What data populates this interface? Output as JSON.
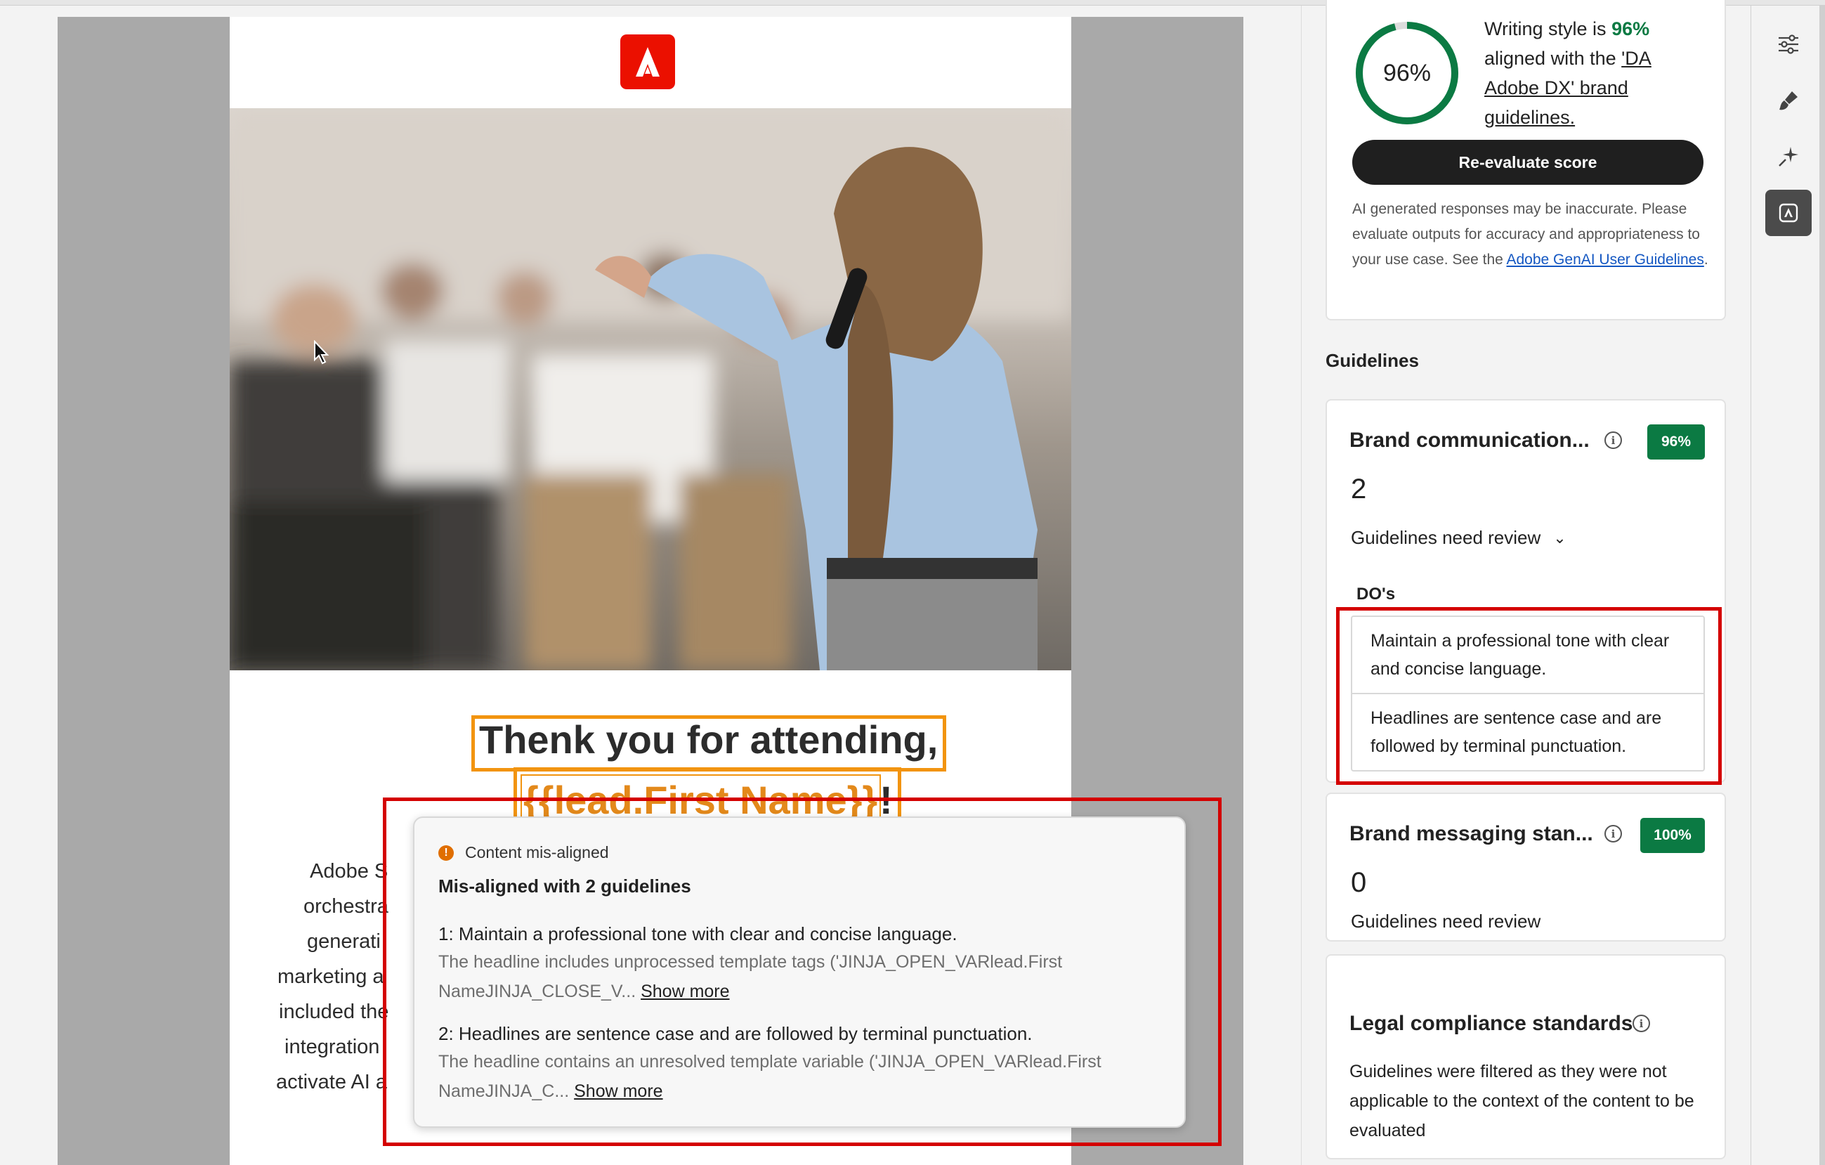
{
  "email": {
    "headline_line1": "Thenk you for attending,",
    "headline_var": "{{lead.First Name}}",
    "headline_punct": "!",
    "body_fragments": [
      "Adobe S",
      "orchestra",
      "generati",
      "marketing a",
      "included the",
      "integration",
      "activate AI a"
    ]
  },
  "popover": {
    "status": "Content mis-aligned",
    "title": "Mis-aligned with 2 guidelines",
    "items": [
      {
        "label": "1: Maintain a professional tone with clear and concise language.",
        "detail_line1": "The headline includes unprocessed template tags ('JINJA_OPEN_VARlead.First",
        "detail_line2": "NameJINJA_CLOSE_V...",
        "show_more": "Show more"
      },
      {
        "label": "2: Headlines are sentence case and are followed by terminal punctuation.",
        "detail_line1": "The headline contains an unresolved template variable ('JINJA_OPEN_VARlead.First",
        "detail_line2": "NameJINJA_C...",
        "show_more": "Show more"
      }
    ]
  },
  "score": {
    "value_label": "96%",
    "value": 96,
    "text_prefix": "Writing style is",
    "text_pct": "96%",
    "text_mid": "aligned with the",
    "guideline_link": "'DA Adobe DX' brand guidelines.",
    "reevaluate_label": "Re-evaluate score",
    "disclaimer": "AI generated responses may be inaccurate. Please evaluate outputs for accuracy and appropriateness to your use case. See the",
    "disclaimer_link": "Adobe GenAI User Guidelines",
    "disclaimer_end": "."
  },
  "guidelines": {
    "heading": "Guidelines",
    "cards": [
      {
        "title": "Brand communication...",
        "badge": "96%",
        "count": "2",
        "review_label": "Guidelines need review",
        "dos_label": "DO's",
        "dos": [
          "Maintain a professional tone with clear and concise language.",
          "Headlines are sentence case and are followed by terminal punctuation."
        ]
      },
      {
        "title": "Brand messaging stan...",
        "badge": "100%",
        "count": "0",
        "review_label": "Guidelines need review"
      },
      {
        "title": "Legal compliance standards",
        "body": "Guidelines were filtered as they were not applicable to the context of the content to be evaluated"
      }
    ]
  },
  "toolbar": [
    "sliders-icon",
    "brush-icon",
    "sparkle-icon",
    "brand-check-icon"
  ],
  "colors": {
    "accent_green": "#0b7a43",
    "highlight_orange": "#f2940f",
    "callout_red": "#d40000",
    "adobe_red": "#eb1000"
  }
}
